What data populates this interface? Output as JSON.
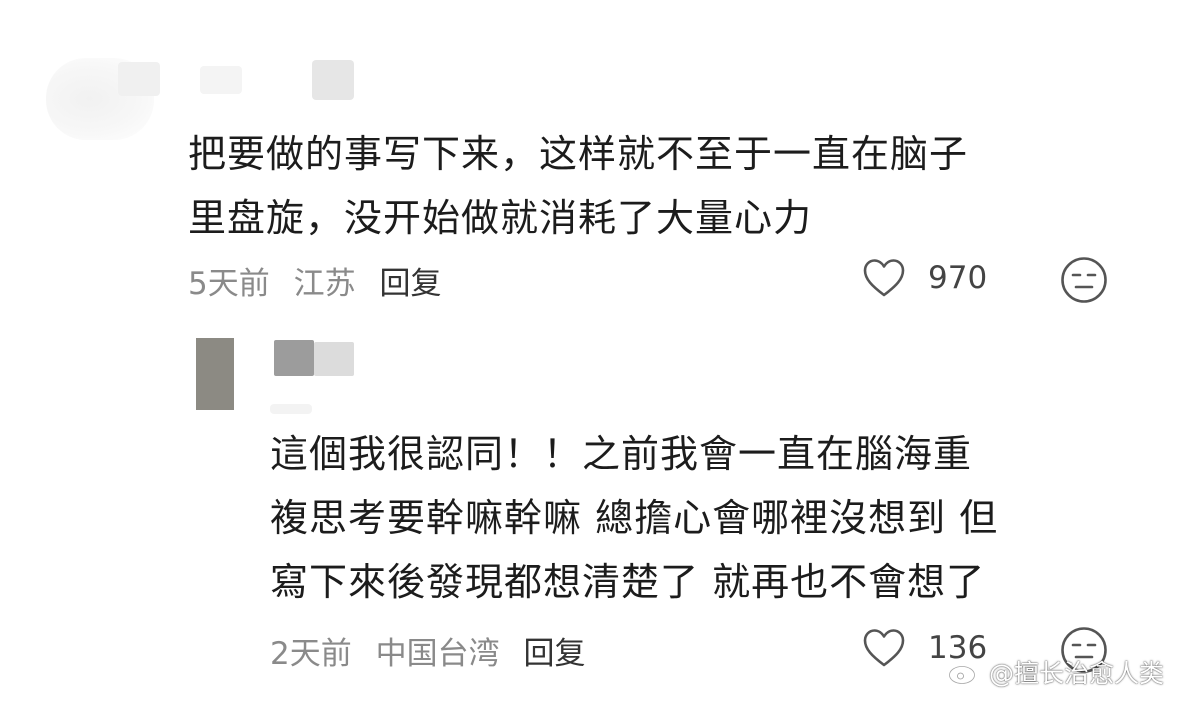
{
  "comments": [
    {
      "text_lines": [
        "把要做的事写下来，这样就不至于一直在脑子",
        "里盘旋，没开始做就消耗了大量心力"
      ],
      "time": "5天前",
      "location": "江苏",
      "reply_label": "回复",
      "like_count": "970"
    },
    {
      "text_lines": [
        "這個我很認同！！之前我會一直在腦海重",
        "複思考要幹嘛幹嘛 總擔心會哪裡沒想到 但",
        "寫下來後發現都想清楚了 就再也不會想了"
      ],
      "time": "2天前",
      "location": "中国台湾",
      "reply_label": "回复",
      "like_count": "136"
    }
  ],
  "watermark": "@擅长治愈人类",
  "icons": {
    "like": "heart-outline-icon",
    "reaction": "expressionless-face-icon",
    "watermark_logo": "weibo-logo-icon"
  },
  "colors": {
    "text": "#1c1c1c",
    "meta": "#8a8a8a",
    "icon": "#555555"
  }
}
